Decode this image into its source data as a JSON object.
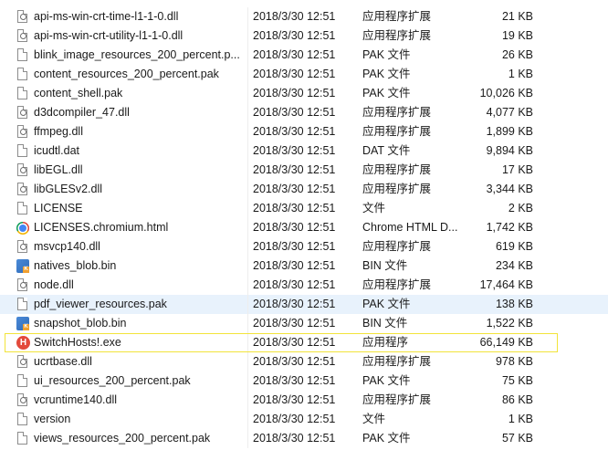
{
  "files": [
    {
      "name": "api-ms-win-crt-time-l1-1-0.dll",
      "date": "2018/3/30 12:51",
      "type": "应用程序扩展",
      "size": "21 KB",
      "icon": "dll-file-icon"
    },
    {
      "name": "api-ms-win-crt-utility-l1-1-0.dll",
      "date": "2018/3/30 12:51",
      "type": "应用程序扩展",
      "size": "19 KB",
      "icon": "dll-file-icon"
    },
    {
      "name": "blink_image_resources_200_percent.p...",
      "date": "2018/3/30 12:51",
      "type": "PAK 文件",
      "size": "26 KB",
      "icon": "file-icon"
    },
    {
      "name": "content_resources_200_percent.pak",
      "date": "2018/3/30 12:51",
      "type": "PAK 文件",
      "size": "1 KB",
      "icon": "file-icon"
    },
    {
      "name": "content_shell.pak",
      "date": "2018/3/30 12:51",
      "type": "PAK 文件",
      "size": "10,026 KB",
      "icon": "file-icon"
    },
    {
      "name": "d3dcompiler_47.dll",
      "date": "2018/3/30 12:51",
      "type": "应用程序扩展",
      "size": "4,077 KB",
      "icon": "dll-file-icon"
    },
    {
      "name": "ffmpeg.dll",
      "date": "2018/3/30 12:51",
      "type": "应用程序扩展",
      "size": "1,899 KB",
      "icon": "dll-file-icon"
    },
    {
      "name": "icudtl.dat",
      "date": "2018/3/30 12:51",
      "type": "DAT 文件",
      "size": "9,894 KB",
      "icon": "file-icon"
    },
    {
      "name": "libEGL.dll",
      "date": "2018/3/30 12:51",
      "type": "应用程序扩展",
      "size": "17 KB",
      "icon": "dll-file-icon"
    },
    {
      "name": "libGLESv2.dll",
      "date": "2018/3/30 12:51",
      "type": "应用程序扩展",
      "size": "3,344 KB",
      "icon": "dll-file-icon"
    },
    {
      "name": "LICENSE",
      "date": "2018/3/30 12:51",
      "type": "文件",
      "size": "2 KB",
      "icon": "file-icon"
    },
    {
      "name": "LICENSES.chromium.html",
      "date": "2018/3/30 12:51",
      "type": "Chrome HTML D...",
      "size": "1,742 KB",
      "icon": "chrome-icon"
    },
    {
      "name": "msvcp140.dll",
      "date": "2018/3/30 12:51",
      "type": "应用程序扩展",
      "size": "619 KB",
      "icon": "dll-file-icon"
    },
    {
      "name": "natives_blob.bin",
      "date": "2018/3/30 12:51",
      "type": "BIN 文件",
      "size": "234 KB",
      "icon": "bin-file-icon"
    },
    {
      "name": "node.dll",
      "date": "2018/3/30 12:51",
      "type": "应用程序扩展",
      "size": "17,464 KB",
      "icon": "dll-file-icon"
    },
    {
      "name": "pdf_viewer_resources.pak",
      "date": "2018/3/30 12:51",
      "type": "PAK 文件",
      "size": "138 KB",
      "icon": "file-icon",
      "hovered": true
    },
    {
      "name": "snapshot_blob.bin",
      "date": "2018/3/30 12:51",
      "type": "BIN 文件",
      "size": "1,522 KB",
      "icon": "bin-file-icon"
    },
    {
      "name": "SwitchHosts!.exe",
      "date": "2018/3/30 12:51",
      "type": "应用程序",
      "size": "66,149 KB",
      "icon": "app-icon",
      "highlighted": true
    },
    {
      "name": "ucrtbase.dll",
      "date": "2018/3/30 12:51",
      "type": "应用程序扩展",
      "size": "978 KB",
      "icon": "dll-file-icon"
    },
    {
      "name": "ui_resources_200_percent.pak",
      "date": "2018/3/30 12:51",
      "type": "PAK 文件",
      "size": "75 KB",
      "icon": "file-icon"
    },
    {
      "name": "vcruntime140.dll",
      "date": "2018/3/30 12:51",
      "type": "应用程序扩展",
      "size": "86 KB",
      "icon": "dll-file-icon"
    },
    {
      "name": "version",
      "date": "2018/3/30 12:51",
      "type": "文件",
      "size": "1 KB",
      "icon": "file-icon"
    },
    {
      "name": "views_resources_200_percent.pak",
      "date": "2018/3/30 12:51",
      "type": "PAK 文件",
      "size": "57 KB",
      "icon": "file-icon"
    }
  ],
  "colors": {
    "hover_bg": "#e8f2fc",
    "highlight_border": "#f2e43a"
  },
  "app_icon_glyph": "H"
}
